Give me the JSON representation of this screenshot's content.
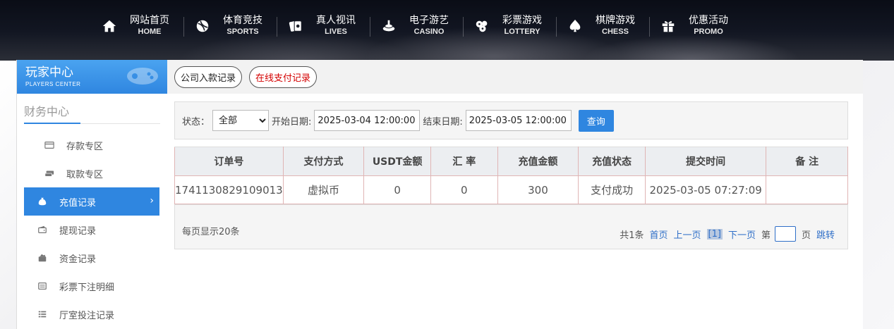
{
  "nav": [
    {
      "cn": "网站首页",
      "en": "HOME",
      "icon": "home-icon"
    },
    {
      "cn": "体育竞技",
      "en": "SPORTS",
      "icon": "ball-icon"
    },
    {
      "cn": "真人视讯",
      "en": "LIVES",
      "icon": "cards-icon"
    },
    {
      "cn": "电子游艺",
      "en": "CASINO",
      "icon": "slot-icon"
    },
    {
      "cn": "彩票游戏",
      "en": "LOTTERY",
      "icon": "lottery-balls-icon"
    },
    {
      "cn": "棋牌游戏",
      "en": "CHESS",
      "icon": "spade-icon"
    },
    {
      "cn": "优惠活动",
      "en": "PROMO",
      "icon": "gift-icon"
    }
  ],
  "sidebar": {
    "title": "玩家中心",
    "subtitle": "PLAYERS CENTER",
    "section": "财务中心",
    "items": [
      {
        "label": "存款专区",
        "icon": "card-icon"
      },
      {
        "label": "取款专区",
        "icon": "cash-icon"
      },
      {
        "label": "充值记录",
        "icon": "money-bag-icon",
        "active": true
      },
      {
        "label": "提现记录",
        "icon": "wallet-icon"
      },
      {
        "label": "资金记录",
        "icon": "coins-icon"
      },
      {
        "label": "彩票下注明细",
        "icon": "list-icon"
      },
      {
        "label": "厅室投注记录",
        "icon": "bullet-list-icon"
      }
    ]
  },
  "tabs": [
    {
      "label": "公司入款记录"
    },
    {
      "label": "在线支付记录"
    }
  ],
  "filter": {
    "status_label": "状态：",
    "status_value": "全部",
    "start_label": "开始日期:",
    "start_value": "2025-03-04 12:00:00",
    "end_label": "结束日期:",
    "end_value": "2025-03-05 12:00:00",
    "query_label": "查询"
  },
  "table": {
    "headers": [
      "订单号",
      "支付方式",
      "USDT金额",
      "汇 率",
      "充值金额",
      "充值状态",
      "提交时间",
      "备 注"
    ],
    "rows": [
      [
        "1741130829109013",
        "虚拟币",
        "0",
        "0",
        "300",
        "支付成功",
        "2025-03-05 07:27:09",
        ""
      ]
    ]
  },
  "pager": {
    "per_page": "每页显示20条",
    "total": "共1条",
    "first": "首页",
    "prev": "上一页",
    "current": "[1]",
    "next": "下一页",
    "page_prefix": "第",
    "page_suffix": "页",
    "jump": "跳转"
  },
  "colors": {
    "accent": "#2f86e0",
    "selected_tab_text": "#d40000"
  }
}
